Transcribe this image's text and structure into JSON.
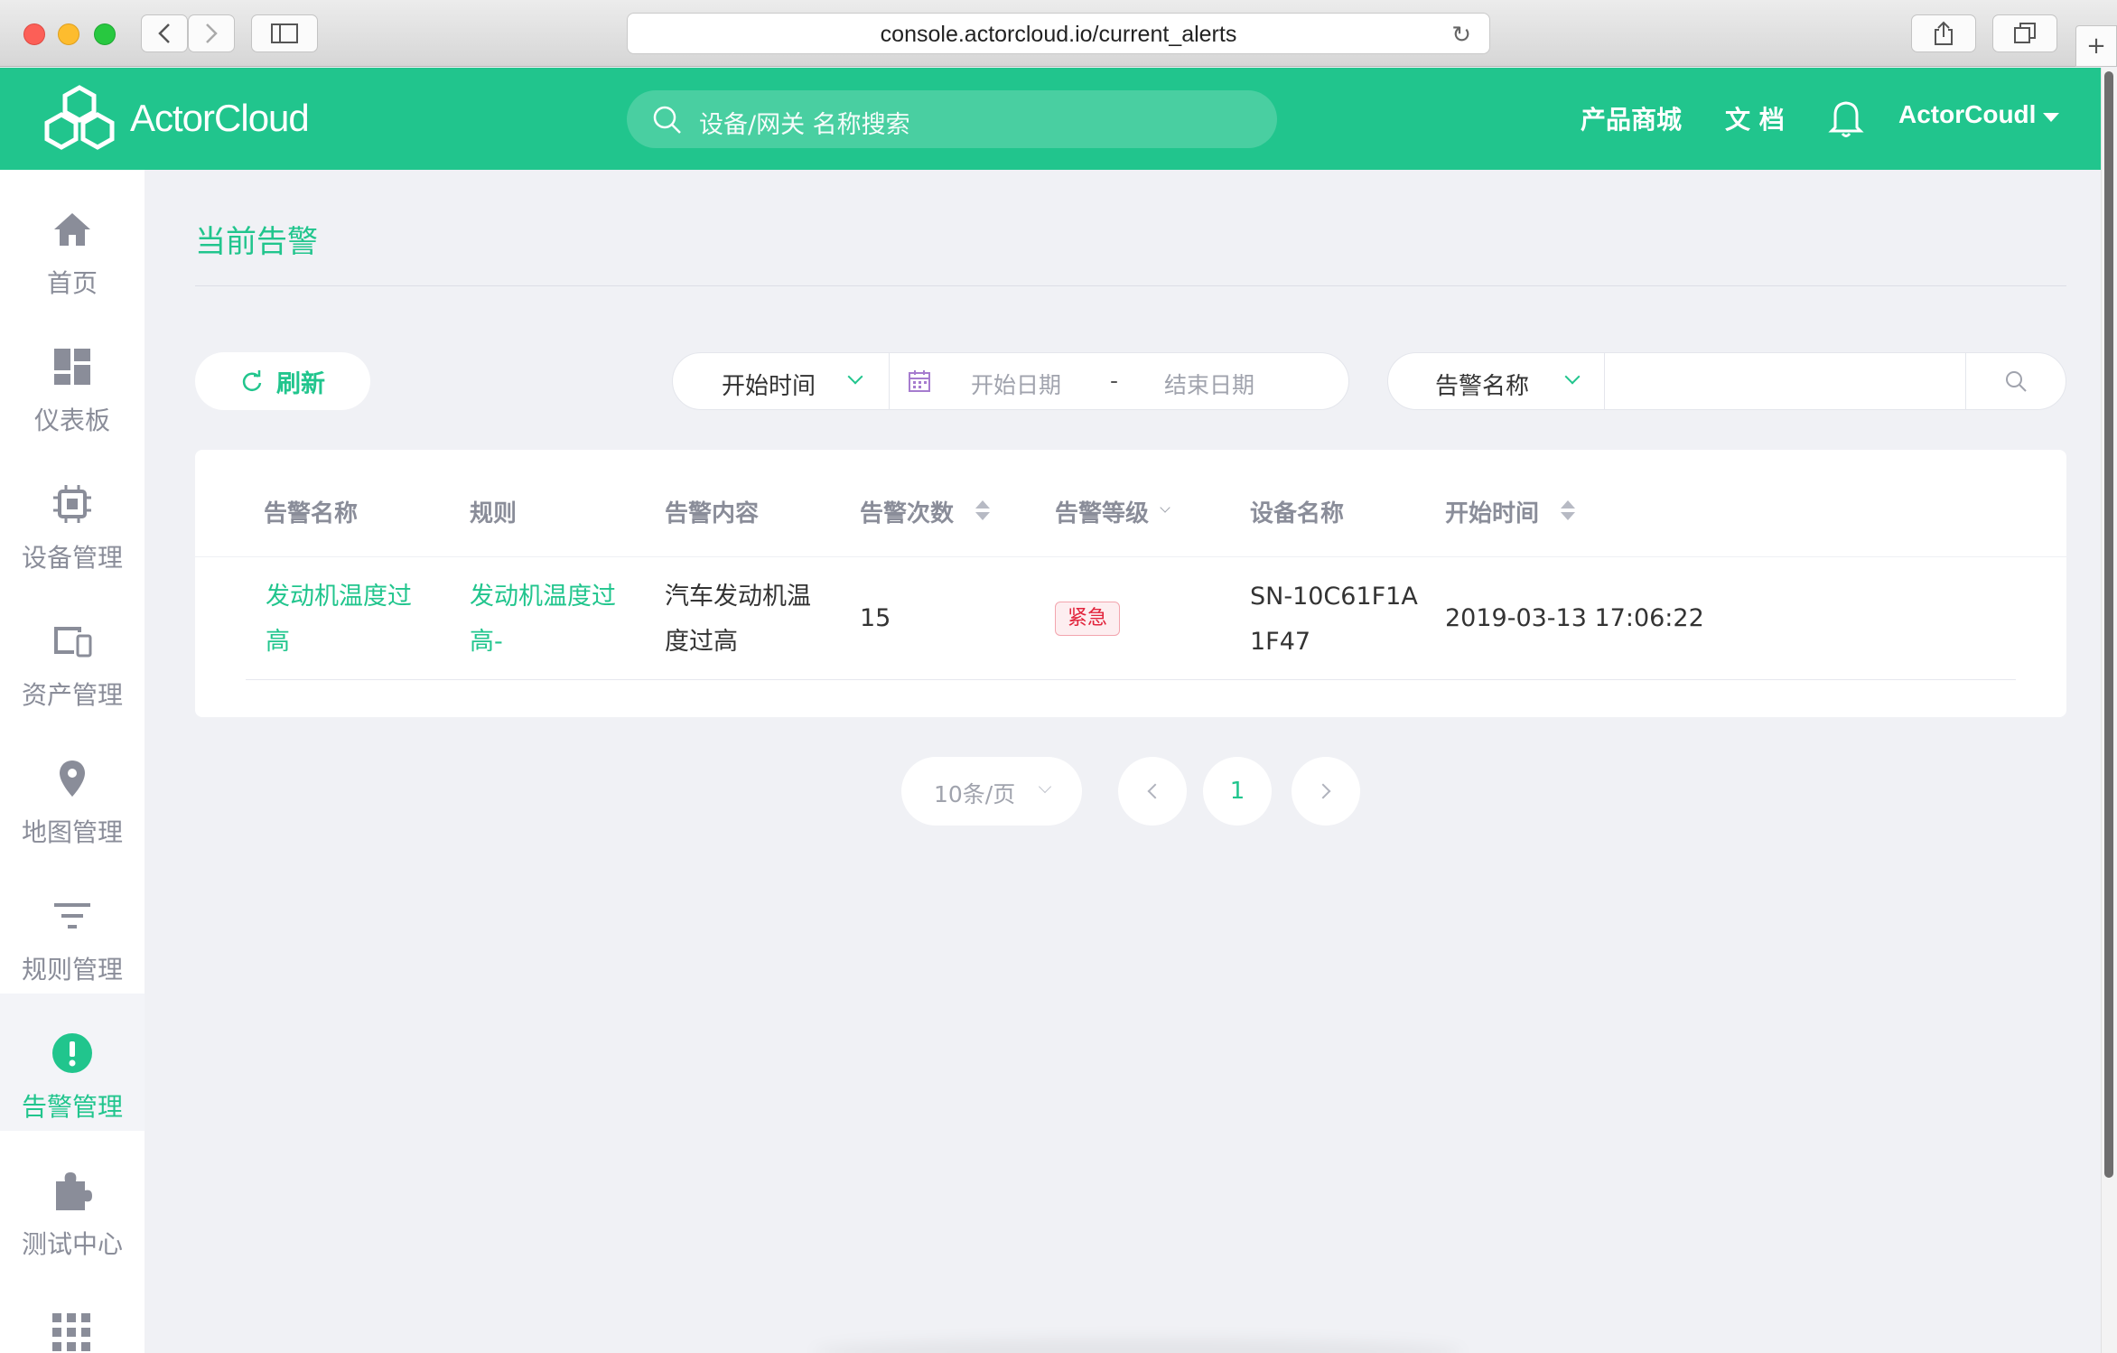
{
  "browser": {
    "url": "console.actorcloud.io/current_alerts"
  },
  "app": {
    "logo_text": "ActorCloud"
  },
  "header": {
    "search_placeholder": "设备/网关 名称搜索",
    "nav": [
      "产品商城",
      "文 档"
    ],
    "user_name": "ActorCoudl"
  },
  "sidebar": {
    "items": [
      {
        "label": "首页",
        "icon": "home-icon"
      },
      {
        "label": "仪表板",
        "icon": "dashboard-icon"
      },
      {
        "label": "设备管理",
        "icon": "chip-icon"
      },
      {
        "label": "资产管理",
        "icon": "devices-icon"
      },
      {
        "label": "地图管理",
        "icon": "map-pin-icon"
      },
      {
        "label": "规则管理",
        "icon": "filter-icon"
      },
      {
        "label": "告警管理",
        "icon": "alert-icon",
        "active": true
      },
      {
        "label": "测试中心",
        "icon": "puzzle-icon"
      }
    ]
  },
  "page": {
    "title": "当前告警",
    "refresh_label": "刷新",
    "time_filter": {
      "selected": "开始时间",
      "start_placeholder": "开始日期",
      "separator": "-",
      "end_placeholder": "结束日期"
    },
    "name_filter": {
      "selected": "告警名称",
      "value": ""
    }
  },
  "table": {
    "columns": [
      "告警名称",
      "规则",
      "告警内容",
      "告警次数",
      "告警等级",
      "设备名称",
      "开始时间"
    ],
    "rows": [
      {
        "alert_name": [
          "发动机温度过",
          "高"
        ],
        "rule": [
          "发动机温度过",
          "高-"
        ],
        "content": [
          "汽车发动机温",
          "度过高"
        ],
        "count": "15",
        "level": "紧急",
        "device": [
          "SN-10C61F1A",
          "1F47"
        ],
        "start_time": "2019-03-13 17:06:22"
      }
    ]
  },
  "pagination": {
    "page_size": "10条/页",
    "current_page": "1"
  },
  "colors": {
    "brand": "#21c58d",
    "danger": "#e2243c"
  }
}
